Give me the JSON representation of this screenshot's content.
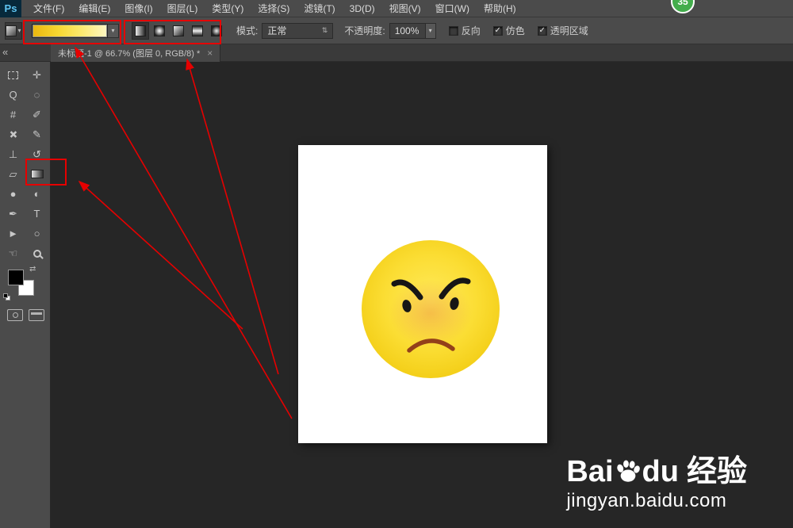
{
  "app": {
    "logo_text": "Ps",
    "menus": [
      "文件(F)",
      "编辑(E)",
      "图像(I)",
      "图层(L)",
      "类型(Y)",
      "选择(S)",
      "滤镜(T)",
      "3D(D)",
      "视图(V)",
      "窗口(W)",
      "帮助(H)"
    ],
    "badge": "35"
  },
  "options_bar": {
    "mode_label": "模式:",
    "mode_value": "正常",
    "opacity_label": "不透明度:",
    "opacity_value": "100%",
    "updown_icon": "⇅",
    "down_icon": "▾",
    "checkboxes": [
      {
        "label": "反向",
        "mark": ""
      },
      {
        "label": "仿色",
        "mark": "✓"
      },
      {
        "label": "透明区域",
        "mark": "✓"
      }
    ],
    "gradient_types": [
      "linear-gradient-icon",
      "radial-gradient-icon",
      "angle-gradient-icon",
      "reflected-gradient-icon",
      "diamond-gradient-icon"
    ]
  },
  "tab_bar": {
    "collapse": "«",
    "title": "未标题-1 @ 66.7% (图层 0, RGB/8) *",
    "close": "×"
  },
  "toolbar": {
    "tools": [
      {
        "name": "rectangular-marquee",
        "glyph": ""
      },
      {
        "name": "move",
        "glyph": "✛"
      },
      {
        "name": "lasso",
        "glyph": "Q"
      },
      {
        "name": "quick-selection",
        "glyph": "◌"
      },
      {
        "name": "crop",
        "glyph": "#"
      },
      {
        "name": "eyedropper",
        "glyph": "✐"
      },
      {
        "name": "spot-healing-brush",
        "glyph": "✚"
      },
      {
        "name": "brush",
        "glyph": "✎"
      },
      {
        "name": "clone-stamp",
        "glyph": "⊥"
      },
      {
        "name": "history-brush",
        "glyph": "↺"
      },
      {
        "name": "eraser",
        "glyph": "▱"
      },
      {
        "name": "gradient",
        "glyph": ""
      },
      {
        "name": "blur",
        "glyph": "●"
      },
      {
        "name": "dodge",
        "glyph": "◐"
      },
      {
        "name": "pen",
        "glyph": "✒"
      },
      {
        "name": "horizontal-type",
        "glyph": "T"
      },
      {
        "name": "path-selection",
        "glyph": "►"
      },
      {
        "name": "ellipse",
        "glyph": "○"
      },
      {
        "name": "hand",
        "glyph": "☜"
      },
      {
        "name": "zoom",
        "glyph": ""
      }
    ]
  },
  "watermark": {
    "brand_a": "Bai",
    "brand_b": "du",
    "brand_suffix": "经验",
    "url": "jingyan.baidu.com"
  },
  "colors": {
    "annotation_red": "#e60000",
    "face_yellow": "#fbdd33",
    "badge_green": "#43ad4c",
    "document_white": "#ffffff"
  }
}
